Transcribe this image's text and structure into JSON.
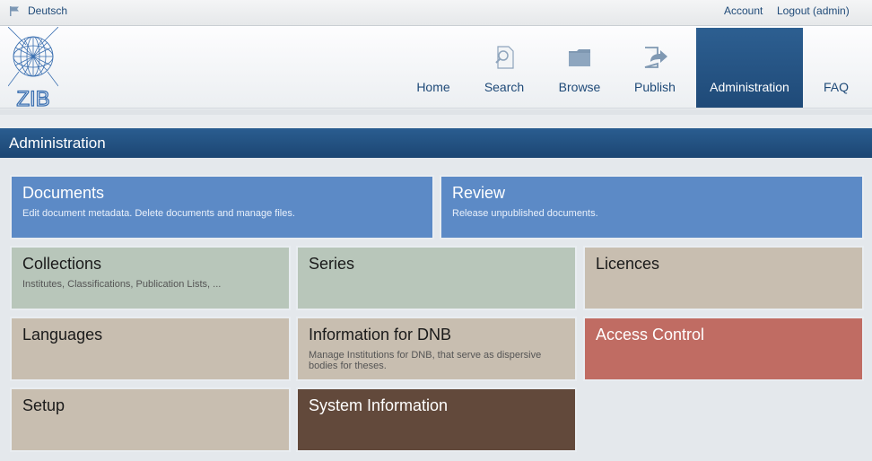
{
  "topbar": {
    "language": "Deutsch",
    "account": "Account",
    "logout": "Logout (admin)"
  },
  "logo": {
    "text": "ZIB"
  },
  "nav": {
    "home": "Home",
    "search": "Search",
    "browse": "Browse",
    "publish": "Publish",
    "administration": "Administration",
    "faq": "FAQ"
  },
  "section": {
    "title": "Administration"
  },
  "tiles": {
    "documents": {
      "title": "Documents",
      "desc": "Edit document metadata. Delete documents and manage files."
    },
    "review": {
      "title": "Review",
      "desc": "Release unpublished documents."
    },
    "collections": {
      "title": "Collections",
      "desc": "Institutes, Classifications, Publication Lists, ..."
    },
    "series": {
      "title": "Series"
    },
    "licences": {
      "title": "Licences"
    },
    "languages": {
      "title": "Languages"
    },
    "dnb": {
      "title": "Information for DNB",
      "desc": "Manage Institutions for DNB, that serve as dispersive bodies for theses."
    },
    "access": {
      "title": "Access Control"
    },
    "setup": {
      "title": "Setup"
    },
    "sysinfo": {
      "title": "System Information"
    }
  },
  "colors": {
    "brand_blue": "#1f4a78",
    "tile_blue": "#5c8ac6",
    "tile_sage": "#b8c6ba",
    "tile_beige": "#c8beb0",
    "tile_red": "#c06c63",
    "tile_brown": "#62493b"
  }
}
